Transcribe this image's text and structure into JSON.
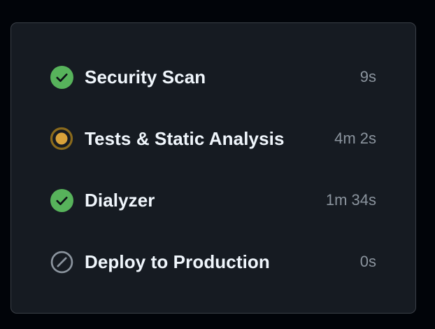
{
  "jobs": [
    {
      "name": "Security Scan",
      "duration": "9s",
      "status": "success",
      "icon": "check-circle-icon"
    },
    {
      "name": "Tests & Static Analysis",
      "duration": "4m 2s",
      "status": "in_progress",
      "icon": "in-progress-icon"
    },
    {
      "name": "Dialyzer",
      "duration": "1m 34s",
      "status": "success",
      "icon": "check-circle-icon"
    },
    {
      "name": "Deploy to Production",
      "duration": "0s",
      "status": "skipped",
      "icon": "skipped-icon"
    }
  ],
  "colors": {
    "background": "#010409",
    "panel": "#161b22",
    "panel_border": "#3a3f47",
    "success": "#57b35b",
    "in_progress": "#d29922",
    "skipped": "#8b949e",
    "text_primary": "#f0f6fc",
    "text_secondary": "#8b949e"
  }
}
